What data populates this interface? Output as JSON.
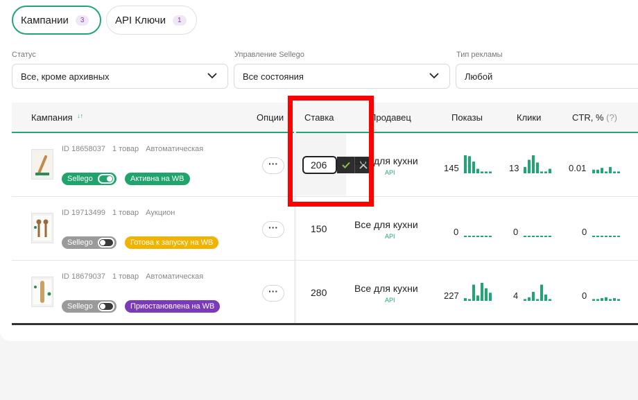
{
  "tabs": [
    {
      "label": "Кампании",
      "count": "3"
    },
    {
      "label": "API Ключи",
      "count": "1"
    }
  ],
  "filters": {
    "status": {
      "label": "Статус",
      "value": "Все, кроме архивных"
    },
    "sellego": {
      "label": "Управление Sellego",
      "value": "Все состояния"
    },
    "adtype": {
      "label": "Тип рекламы",
      "value": "Любой"
    }
  },
  "columns": {
    "campaign": "Кампания",
    "campaign_sort": "↓↑",
    "options": "Опции",
    "bid": "Ставка",
    "seller": "Продавец",
    "impressions": "Показы",
    "clicks": "Клики",
    "ctr": "CTR, %",
    "ctr_help": "(?)"
  },
  "rows": [
    {
      "id": "ID 18658037",
      "items": "1 товар",
      "type": "Автоматическая",
      "sellego_label": "Sellego",
      "sellego_on": true,
      "status": "Активна на WB",
      "status_color": "#1fa56b",
      "bid": "206",
      "seller": "Все для кухни",
      "seller_sub": "API",
      "impressions": "145",
      "clicks": "13",
      "ctr": "0.01",
      "imp_spark": [
        1,
        0.95,
        0.65,
        0.25,
        0.1,
        0.1,
        0.1
      ],
      "clk_spark": [
        0.35,
        0.75,
        1,
        0.6,
        0.1,
        0.1,
        0.25
      ],
      "ctr_spark": [
        0.2,
        0.2,
        0.3,
        0.1,
        0.35,
        0.1,
        0.1
      ]
    },
    {
      "id": "ID 19713499",
      "items": "1 товар",
      "type": "Аукцион",
      "sellego_label": "Sellego",
      "sellego_on": false,
      "status": "Готова к запуску на WB",
      "status_color": "#f0b400",
      "bid": "150",
      "seller": "Все для кухни",
      "seller_sub": "API",
      "impressions": "0",
      "clicks": "0",
      "ctr": "0",
      "imp_spark": [
        0,
        0,
        0,
        0,
        0,
        0,
        0
      ],
      "clk_spark": [
        0,
        0,
        0,
        0,
        0,
        0,
        0
      ],
      "ctr_spark": [
        0,
        0,
        0,
        0,
        0,
        0,
        0
      ]
    },
    {
      "id": "ID 18679037",
      "items": "1 товар",
      "type": "Автоматическая",
      "sellego_label": "Sellego",
      "sellego_on": false,
      "status": "Приостановлена на WB",
      "status_color": "#7b3bb8",
      "bid": "280",
      "seller": "Все для кухни",
      "seller_sub": "API",
      "impressions": "227",
      "clicks": "4",
      "ctr": "0",
      "imp_spark": [
        0.15,
        0.1,
        0.9,
        0.3,
        1,
        0.7,
        0.45
      ],
      "clk_spark": [
        0.1,
        0.2,
        0.5,
        0.1,
        0.9,
        0.35,
        0.1
      ],
      "ctr_spark": [
        0.1,
        0.1,
        0.15,
        0.2,
        0.1,
        0.15,
        0.1
      ]
    }
  ]
}
